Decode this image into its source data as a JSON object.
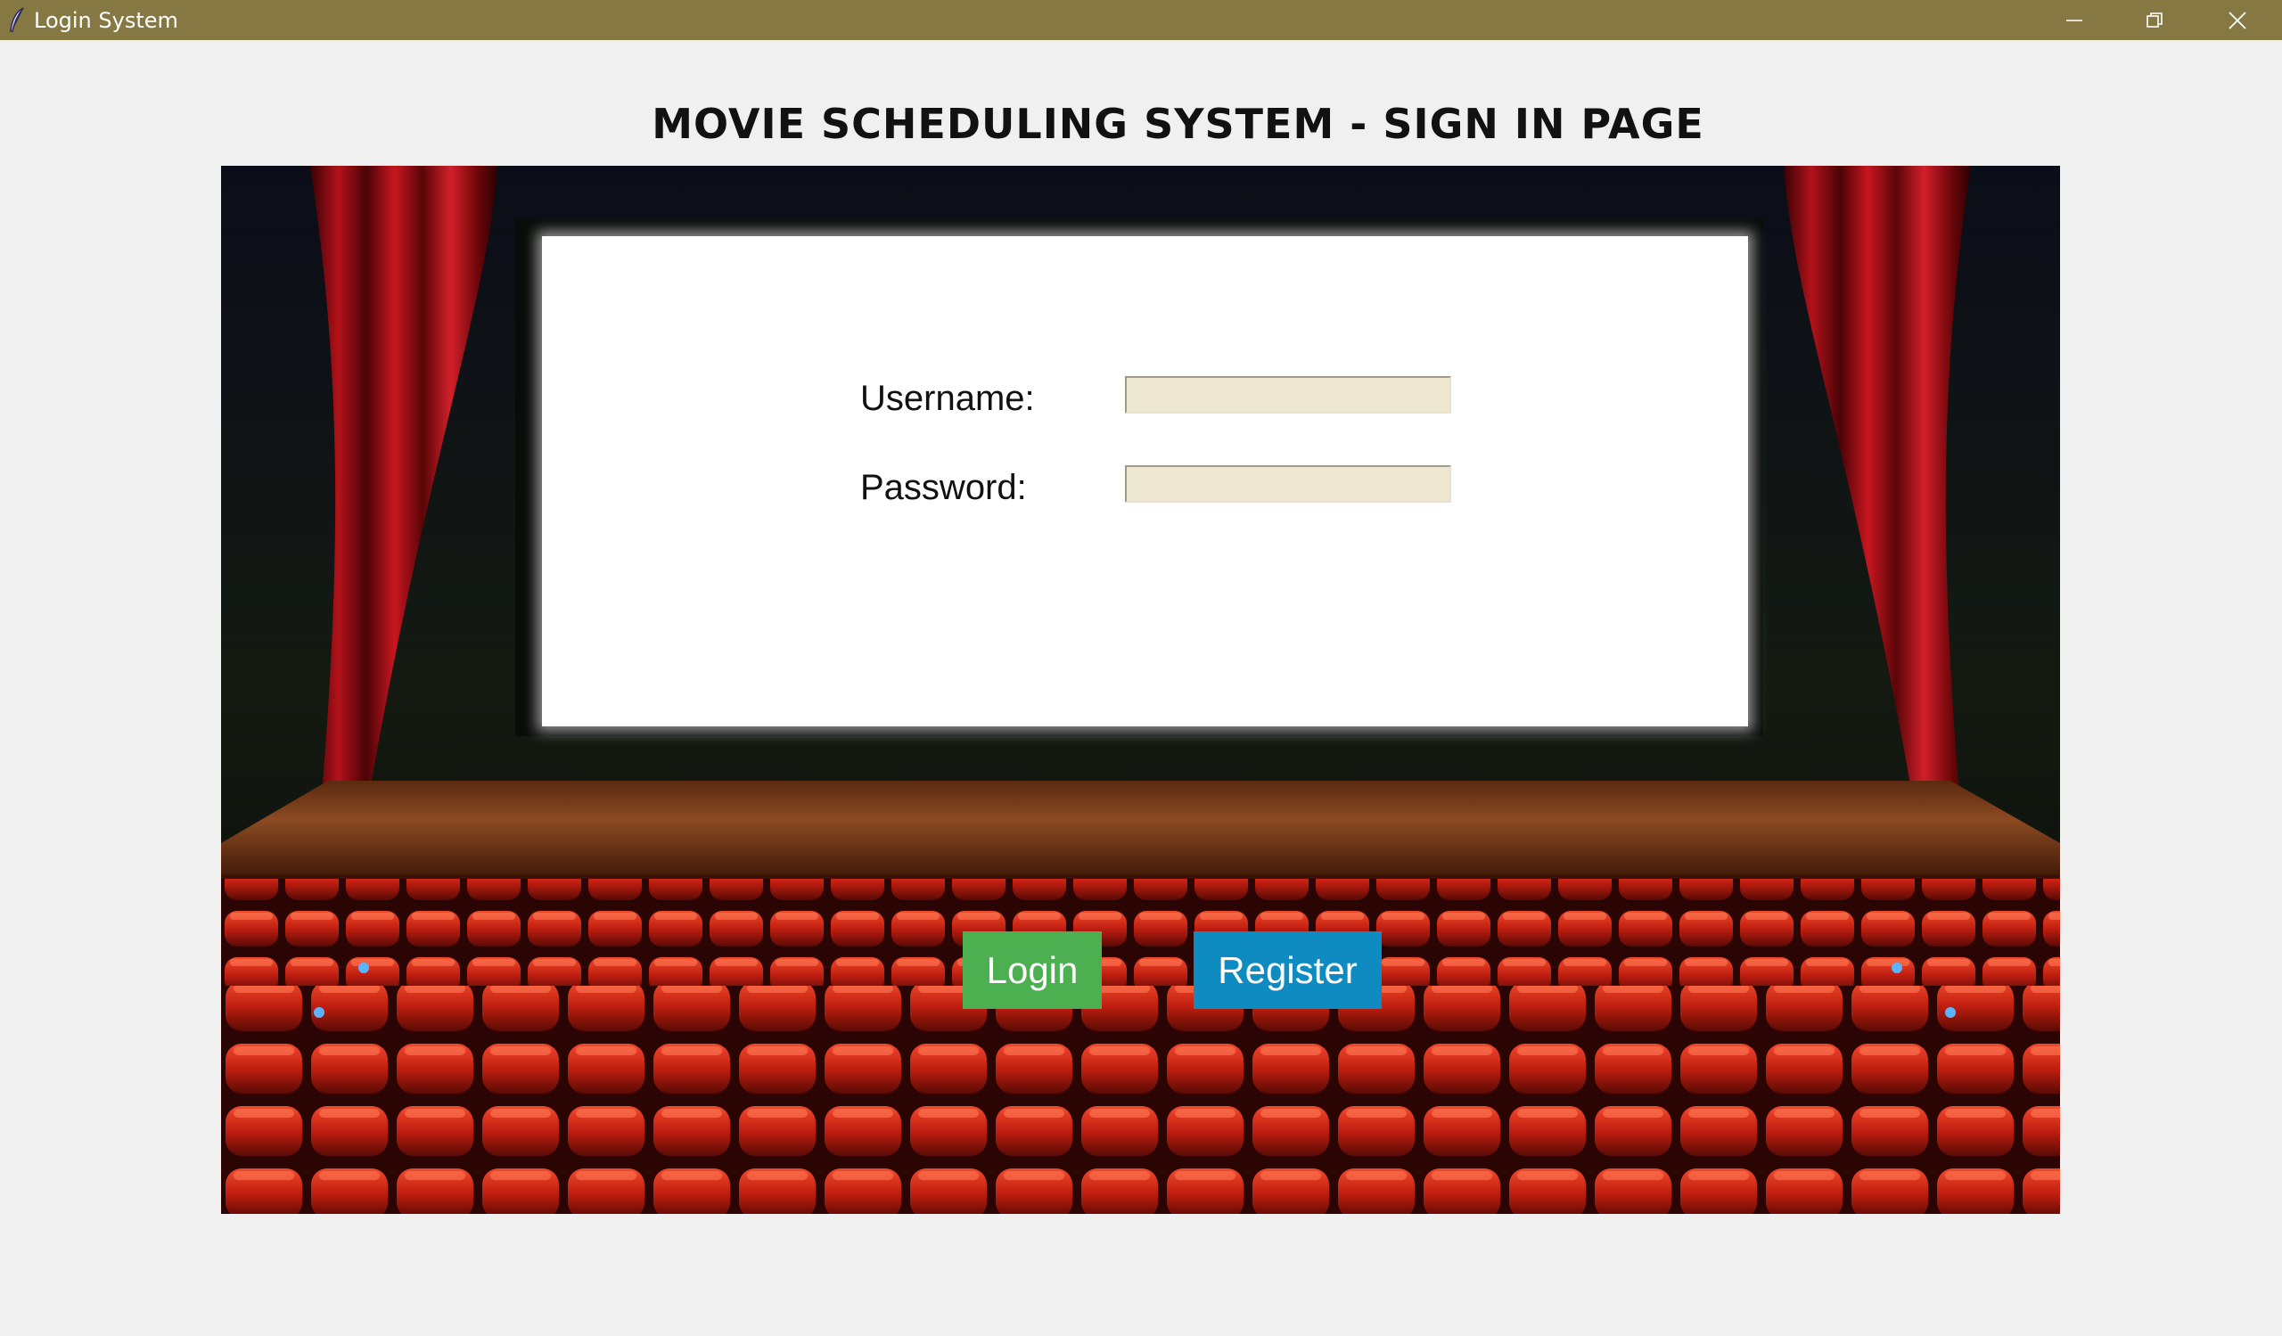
{
  "window": {
    "title": "Login System",
    "controls": {
      "minimize_icon": "minimize-icon",
      "maximize_icon": "restore-icon",
      "close_icon": "close-icon"
    }
  },
  "page": {
    "title": "MOVIE SCHEDULING SYSTEM - SIGN IN PAGE"
  },
  "form": {
    "username_label": "Username:",
    "username_value": "",
    "password_label": "Password:",
    "password_value": ""
  },
  "buttons": {
    "login_label": "Login",
    "register_label": "Register"
  },
  "colors": {
    "titlebar": "#857843",
    "login_button": "#4caf50",
    "register_button": "#0e8bc0",
    "input_background": "#eee8d3"
  }
}
